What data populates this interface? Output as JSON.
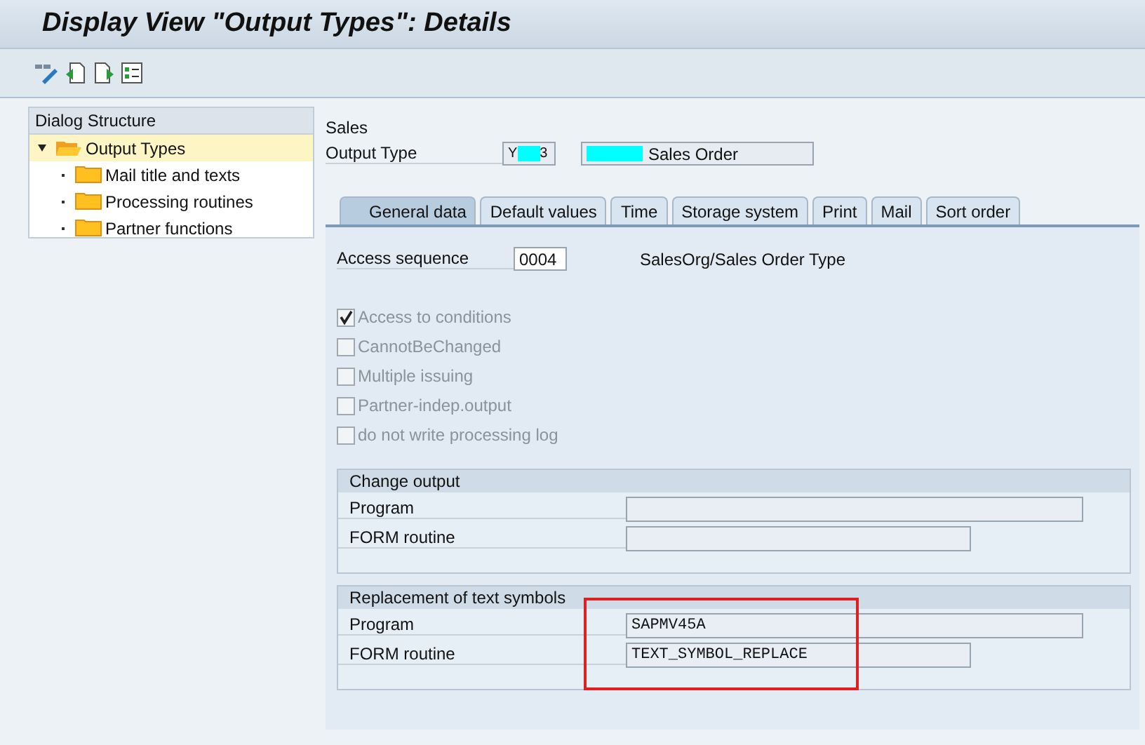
{
  "window": {
    "title": "Display View \"Output Types\": Details"
  },
  "toolbar": {
    "buttons": [
      {
        "kind": "glasses"
      },
      {
        "kind": "prev"
      },
      {
        "kind": "next"
      },
      {
        "kind": "select"
      }
    ]
  },
  "dialog_structure": {
    "title": "Dialog Structure",
    "items": [
      {
        "label": "Output Types",
        "selected": true,
        "expanded": true,
        "children": [
          {
            "label": "Mail title and texts",
            "selected": false
          },
          {
            "label": "Processing routines",
            "selected": false
          },
          {
            "label": "Partner functions",
            "selected": false
          }
        ]
      }
    ]
  },
  "header": {
    "section": "Sales",
    "output_type_label": "Output Type",
    "output_type_start": "Y",
    "output_type_end": "3",
    "description": "Sales Order"
  },
  "tabs": [
    {
      "label": "General data",
      "selected": true
    },
    {
      "label": "Default values",
      "selected": false
    },
    {
      "label": "Time",
      "selected": false
    },
    {
      "label": "Storage system",
      "selected": false
    },
    {
      "label": "Print",
      "selected": false
    },
    {
      "label": "Mail",
      "selected": false
    },
    {
      "label": "Sort order",
      "selected": false
    }
  ],
  "access_sequence": {
    "label": "Access sequence",
    "value": "0004",
    "description": "SalesOrg/Sales Order Type"
  },
  "checkboxes": [
    {
      "label": "Access to conditions",
      "checked": true,
      "disabled": true
    },
    {
      "label": "CannotBeChanged",
      "checked": false,
      "disabled": true
    },
    {
      "label": "Multiple issuing",
      "checked": false,
      "disabled": true
    },
    {
      "label": "Partner-indep.output",
      "checked": false,
      "disabled": true
    },
    {
      "label": "do not write processing log",
      "checked": false,
      "disabled": true
    }
  ],
  "groups": [
    {
      "title": "Change output",
      "highlighted": false,
      "fields": [
        {
          "label": "Program",
          "wide": true
        },
        {
          "label": "FORM routine",
          "wide": false
        }
      ]
    },
    {
      "title": "Replacement of text symbols",
      "highlighted": true,
      "fields": [
        {
          "label": "Program",
          "value": "SAPMV45A",
          "wide": true
        },
        {
          "label": "FORM routine",
          "value": "TEXT_SYMBOL_REPLACE",
          "wide": false
        }
      ]
    }
  ]
}
